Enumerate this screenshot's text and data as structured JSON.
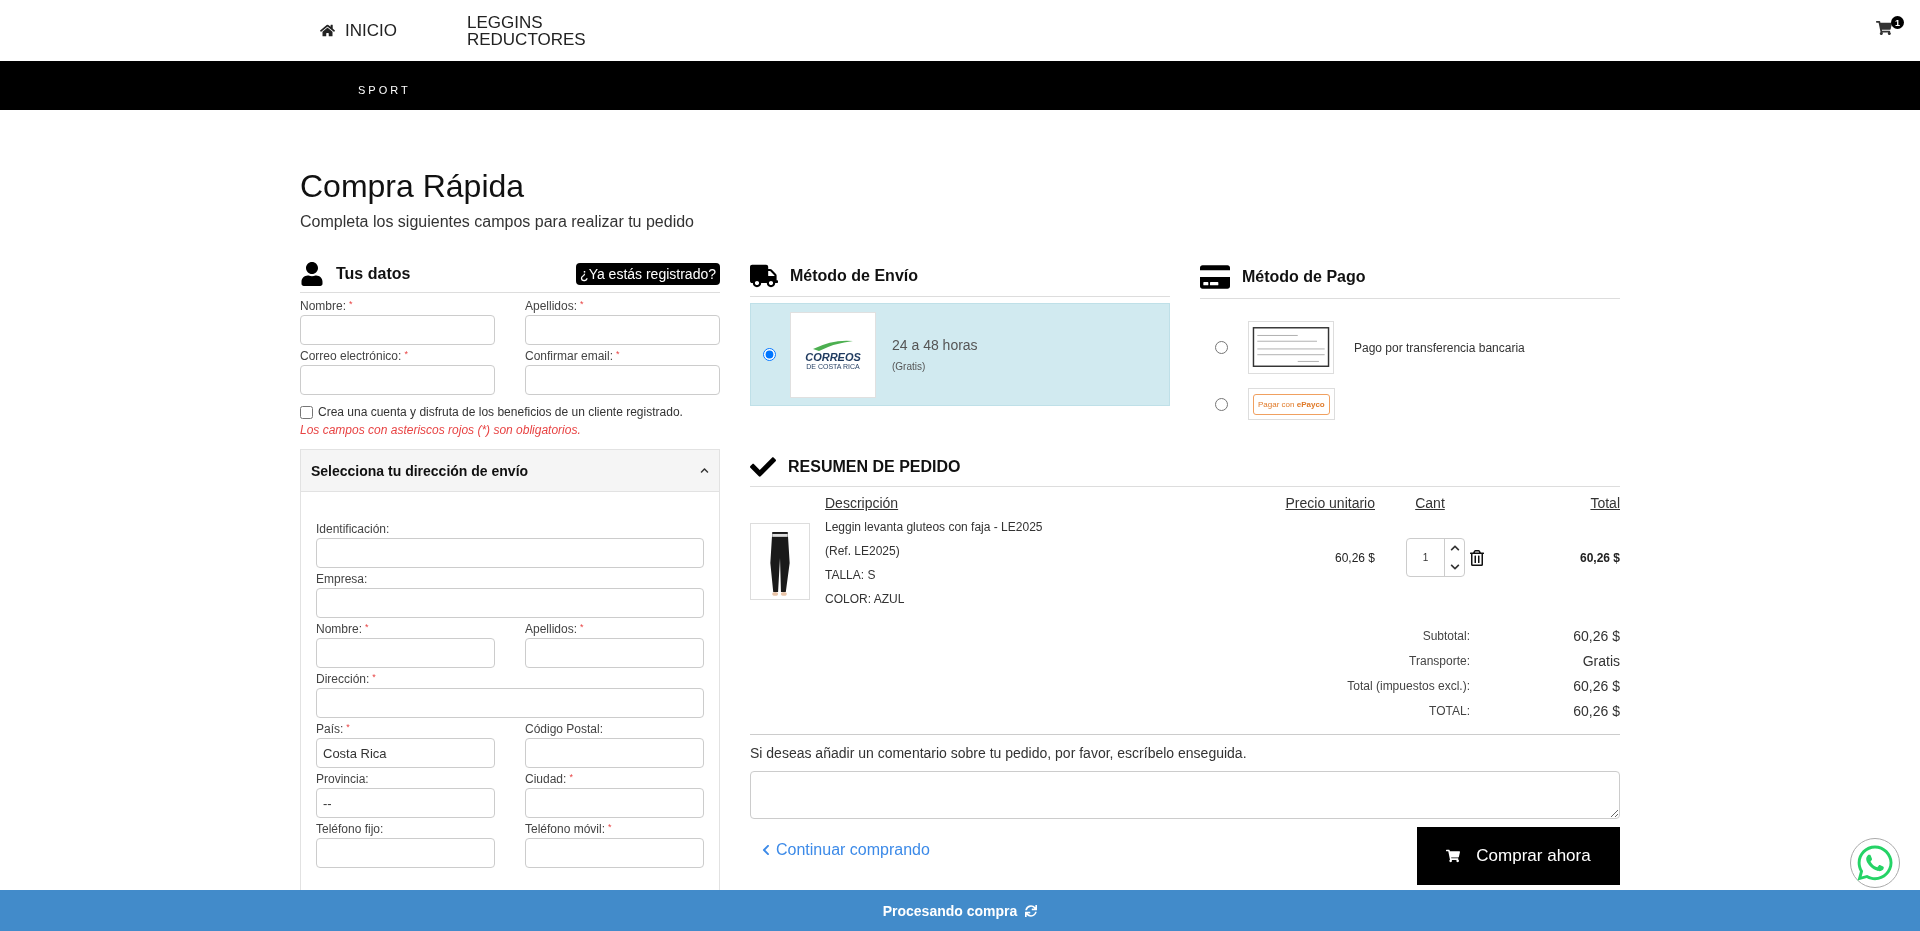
{
  "nav": {
    "items": [
      {
        "label": "INICIO",
        "kind": "home"
      },
      {
        "label": "LEGGINS REDUCTORES",
        "kind": "plain"
      }
    ],
    "cart_count": "1",
    "logo_text": "SPORT"
  },
  "page": {
    "title": "Compra Rápida",
    "subtitle": "Completa los siguientes campos para realizar tu pedido"
  },
  "customer": {
    "title": "Tus datos",
    "login_button": "¿Ya estás registrado?",
    "fields": [
      {
        "label": "Nombre:",
        "required_mark": "*"
      },
      {
        "label": "Apellidos:",
        "required_mark": "*"
      },
      {
        "label": "Correo electrónico:",
        "required_mark": "*"
      },
      {
        "label": "Confirmar email:",
        "required_mark": "*"
      }
    ],
    "create_account": {
      "label": "Crea una cuenta y disfruta de los beneficios de un cliente registrado.",
      "checked": false
    },
    "required_note": "Los campos con asteriscos rojos (*) son obligatorios."
  },
  "address": {
    "title": "Selecciona tu dirección de envío",
    "expanded": true,
    "fields": [
      {
        "label": "Identificación:",
        "kind": "wide"
      },
      {
        "label": "Empresa:",
        "kind": "wide"
      },
      {
        "label": "Nombre:",
        "required_mark": "*",
        "kind": "half"
      },
      {
        "label": "Apellidos:",
        "required_mark": "*",
        "kind": "half"
      },
      {
        "label": "Dirección:",
        "required_mark": "*",
        "kind": "wide"
      },
      {
        "label": "País:",
        "required_mark": "*",
        "kind": "half",
        "value": "Costa Rica"
      },
      {
        "label": "Código Postal:",
        "kind": "half"
      },
      {
        "label": "Provincia:",
        "kind": "half",
        "value": "--"
      },
      {
        "label": "Ciudad:",
        "required_mark": "*",
        "kind": "half"
      },
      {
        "label": "Teléfono fijo:",
        "kind": "half"
      },
      {
        "label": "Teléfono móvil:",
        "required_mark": "*",
        "kind": "half"
      }
    ]
  },
  "shipping": {
    "title": "Método de Envío",
    "options": [
      {
        "logo_text": "CORREOS",
        "logo_subtext": "DE COSTA RICA",
        "delay": "24 a 48 horas",
        "price": "(Gratis)",
        "selected": true
      }
    ]
  },
  "payment": {
    "title": "Método de Pago",
    "options": [
      {
        "kind": "check",
        "label": "Pago por transferencia bancaria",
        "selected": false
      },
      {
        "kind": "badge",
        "badge": "Pagar con **ePayco**",
        "selected": false
      }
    ]
  },
  "summary": {
    "title": "RESUMEN DE PEDIDO",
    "columns": [
      "Descripción",
      "Precio unitario",
      "Cant",
      "Total"
    ],
    "rows": [
      {
        "name": "Leggin levanta gluteos con faja - LE2025",
        "details": [
          "(Ref. LE2025)",
          "TALLA: S",
          "COLOR: AZUL"
        ],
        "price": "60,26 $",
        "quantity": "1",
        "total": "60,26 $"
      }
    ],
    "totals": [
      {
        "label": "Subtotal:",
        "value": "60,26 $"
      },
      {
        "label": "Transporte:",
        "value": "Gratis"
      },
      {
        "label": "Total (impuestos excl.):",
        "value": "60,26 $"
      },
      {
        "label": "TOTAL:",
        "value": "60,26 $"
      }
    ]
  },
  "comment": {
    "label": "Si deseas añadir un comentario sobre tu pedido, por favor, escríbelo enseguida."
  },
  "actions": {
    "continue": "Continuar comprando",
    "buy": "Comprar ahora"
  },
  "status_bar": {
    "text": "Procesando compra"
  }
}
